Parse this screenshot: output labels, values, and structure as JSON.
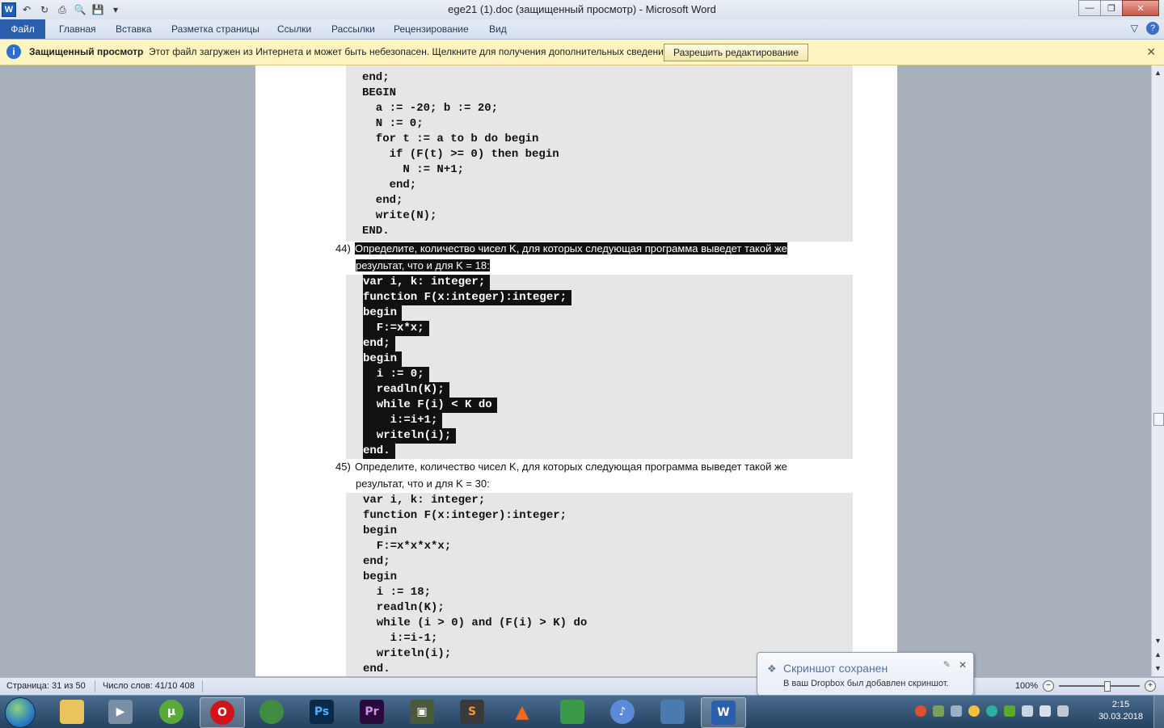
{
  "window": {
    "title": "ege21 (1).doc (защищенный просмотр) - Microsoft Word"
  },
  "ribbon": {
    "file_tab": "Файл",
    "tabs": [
      "Главная",
      "Вставка",
      "Разметка страницы",
      "Ссылки",
      "Рассылки",
      "Рецензирование",
      "Вид"
    ]
  },
  "protected_view": {
    "title": "Защищенный просмотр",
    "message": "Этот файл загружен из Интернета и может быть небезопасен. Щелкните для получения дополнительных сведений.",
    "button": "Разрешить редактирование"
  },
  "document": {
    "block1_lines": [
      "end;",
      "BEGIN",
      "  a := -20; b := 20;",
      "  N := 0;",
      "  for t := a to b do begin",
      "    if (F(t) >= 0) then begin",
      "      N := N+1;",
      "    end;",
      "  end;",
      "  write(N);",
      "END."
    ],
    "q44": {
      "number": "44)",
      "text_line1": "Определите, количество чисел K, для которых следующая программа выведет такой же",
      "text_line2": "результат, что и для K = 18:",
      "code": [
        "var i, k: integer;",
        "function F(x:integer):integer;",
        "begin",
        "  F:=x*x;",
        "end;",
        "begin",
        "  i := 0;",
        "  readln(K);",
        "  while F(i) < K do",
        "    i:=i+1;",
        "  writeln(i);",
        "end."
      ]
    },
    "q45": {
      "number": "45)",
      "text_line1": "Определите, количество чисел K, для которых следующая программа выведет такой же",
      "text_line2": "результат, что и для K = 30:",
      "code": [
        "var i, k: integer;",
        "function F(x:integer):integer;",
        "begin",
        "  F:=x*x*x*x;",
        "end;",
        "begin",
        "  i := 18;",
        "  readln(K);",
        "  while (i > 0) and (F(i) > K) do",
        "    i:=i-1;",
        "  writeln(i);",
        "end."
      ]
    }
  },
  "status": {
    "page": "Страница: 31 из 50",
    "words": "Число слов: 41/10 408",
    "zoom": "100%"
  },
  "toast": {
    "title": "Скриншот сохранен",
    "message": "В ваш Dropbox был добавлен скриншот."
  },
  "taskbar": {
    "time": "2:15",
    "date": "30.03.2018"
  }
}
